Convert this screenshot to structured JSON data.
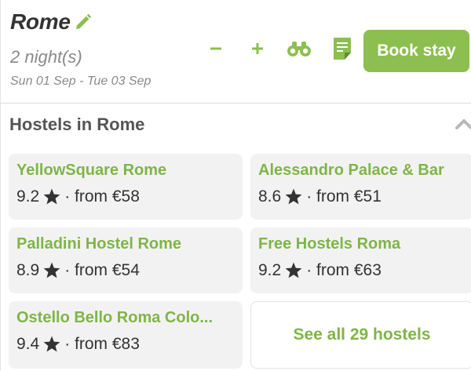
{
  "colors": {
    "accent": "#8cbf4f",
    "accent_text": "#7fb547",
    "text": "#333333",
    "muted": "#8a8a8a",
    "card_bg": "#f2f2f2"
  },
  "trip": {
    "city": "Rome",
    "nights": "2 night(s)",
    "dates": "Sun 01 Sep - Tue 03 Sep"
  },
  "toolbar": {
    "minus_icon": "minus-icon",
    "plus_icon": "plus-icon",
    "binoculars_icon": "binoculars-icon",
    "note_icon": "note-icon",
    "book_label": "Book stay"
  },
  "section": {
    "title": "Hostels in Rome",
    "toggle_icon": "chevron-up-icon"
  },
  "hostels": [
    {
      "name": "YellowSquare Rome",
      "rating": "9.2",
      "price": "· from €58"
    },
    {
      "name": "Alessandro Palace & Bar",
      "rating": "8.6",
      "price": "· from €51"
    },
    {
      "name": "Palladini Hostel Rome",
      "rating": "8.9",
      "price": "· from €54"
    },
    {
      "name": "Free Hostels Roma",
      "rating": "9.2",
      "price": "· from €63"
    },
    {
      "name": "Ostello Bello Roma Colo...",
      "rating": "9.4",
      "price": "· from €83"
    }
  ],
  "see_all_label": "See all 29 hostels"
}
